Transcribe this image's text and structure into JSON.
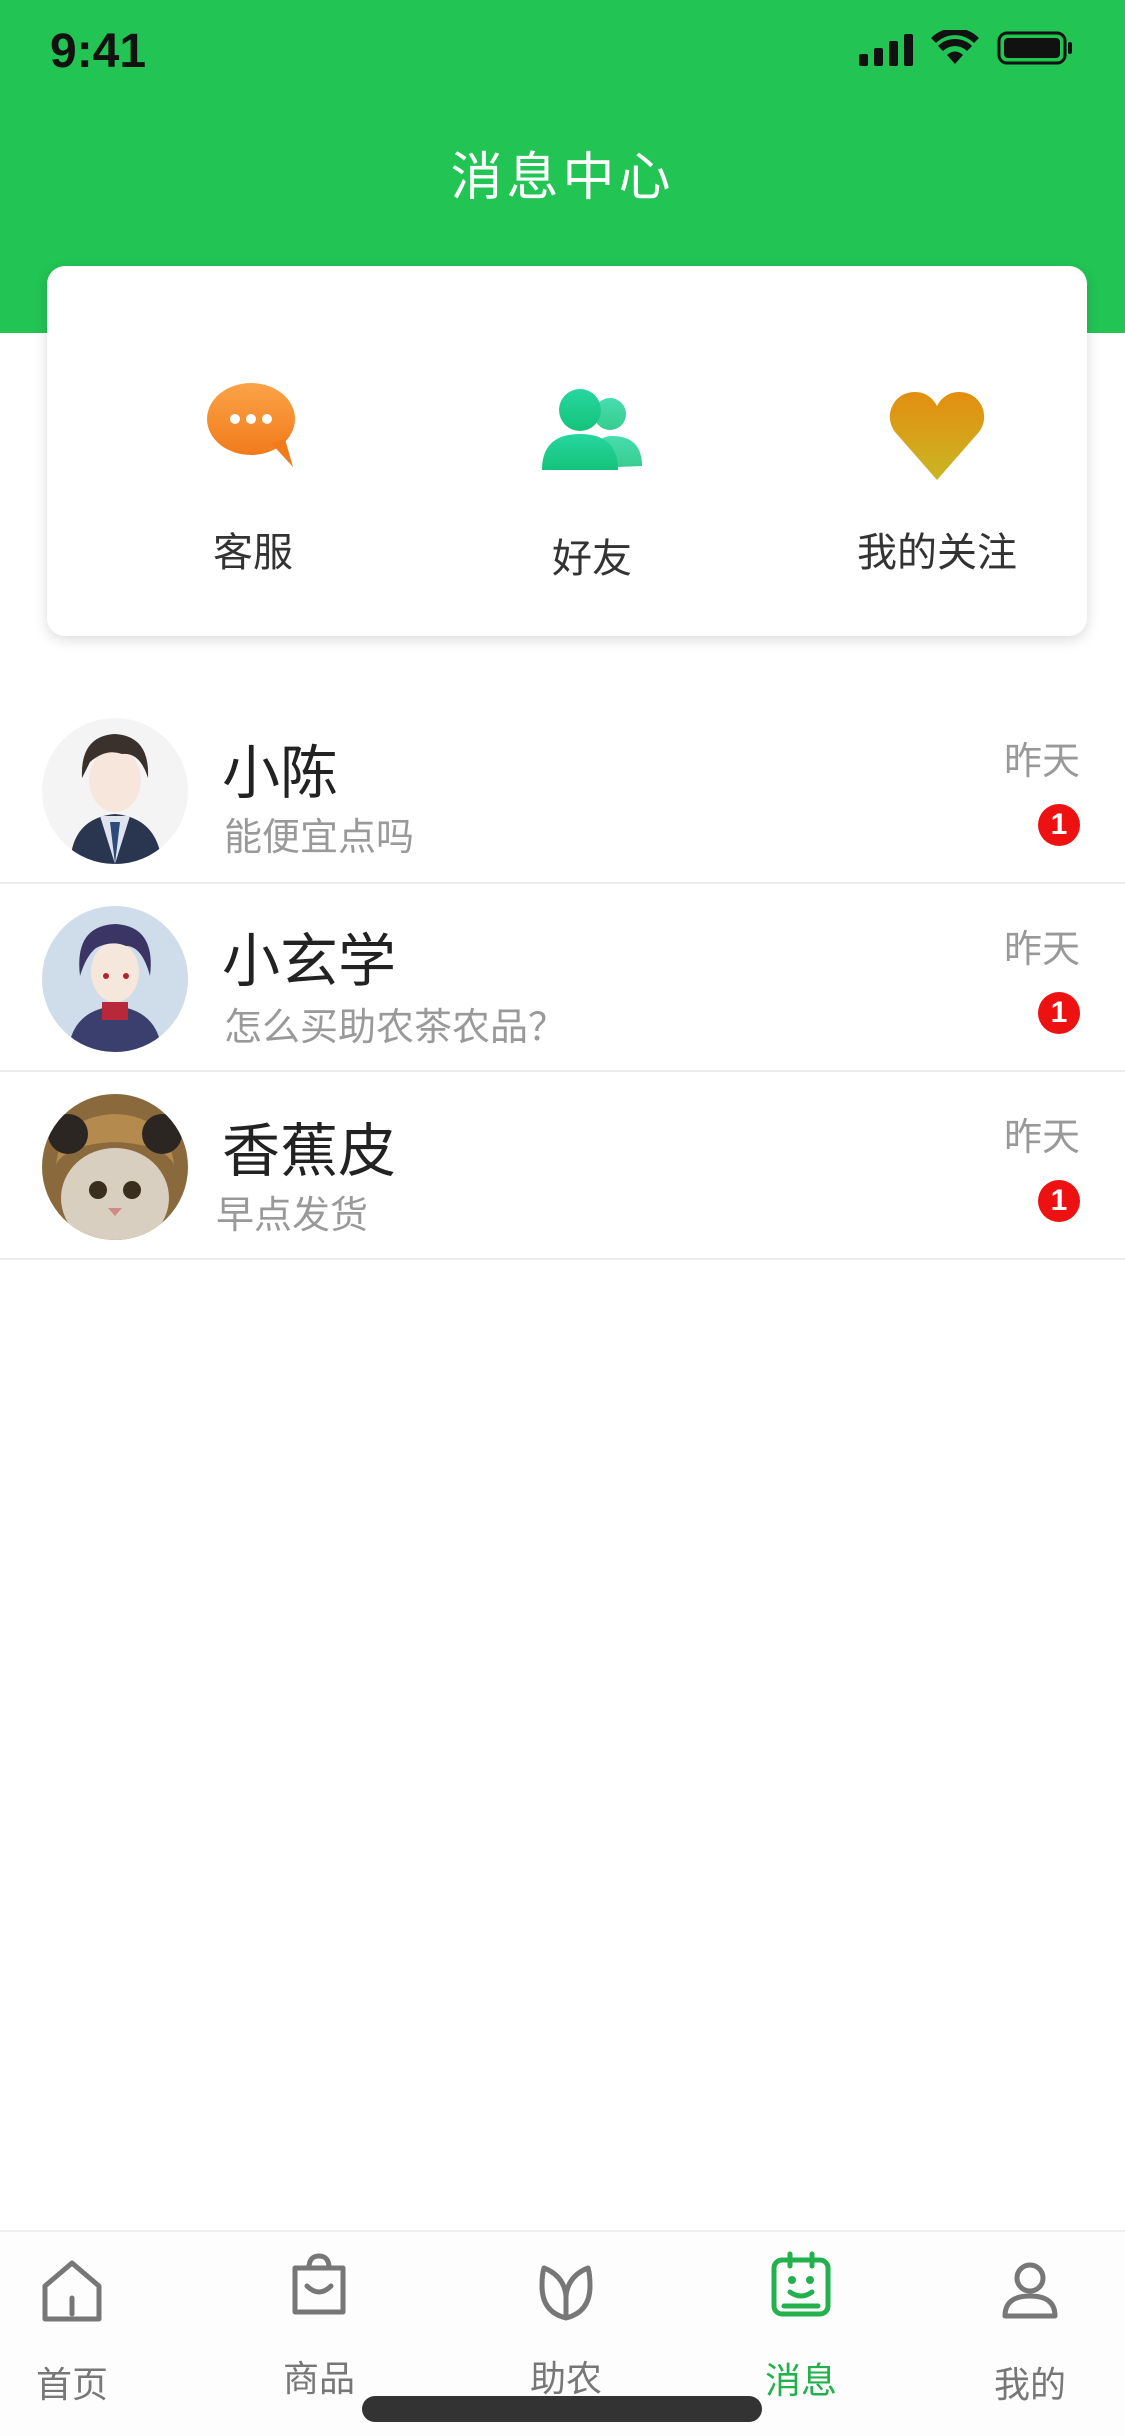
{
  "status_bar": {
    "time": "9:41"
  },
  "header": {
    "title": "消息中心"
  },
  "quick_actions": [
    {
      "label": "客服",
      "icon": "chat-bubble-icon"
    },
    {
      "label": "好友",
      "icon": "friends-icon"
    },
    {
      "label": "我的关注",
      "icon": "heart-icon"
    }
  ],
  "messages": [
    {
      "name": "小陈",
      "preview": "能便宜点吗",
      "time": "昨天",
      "unread": "1"
    },
    {
      "name": "小玄学",
      "preview": "怎么买助农茶农品？",
      "time": "昨天",
      "unread": "1"
    },
    {
      "name": "香蕉皮",
      "preview": "早点发货",
      "time": "昨天",
      "unread": "1"
    }
  ],
  "tabs": [
    {
      "label": "首页",
      "icon": "home-icon"
    },
    {
      "label": "商品",
      "icon": "shopping-bag-icon"
    },
    {
      "label": "助农",
      "icon": "leaf-icon"
    },
    {
      "label": "消息",
      "icon": "message-icon",
      "active": true
    },
    {
      "label": "我的",
      "icon": "user-icon"
    }
  ],
  "colors": {
    "brand_green": "#22c454",
    "active_tab": "#22b14c",
    "badge_red": "#ee1111",
    "chat_orange": "#f7902a",
    "friends_teal": "#1fcf8c",
    "heart_gold": "#d99a0e"
  }
}
